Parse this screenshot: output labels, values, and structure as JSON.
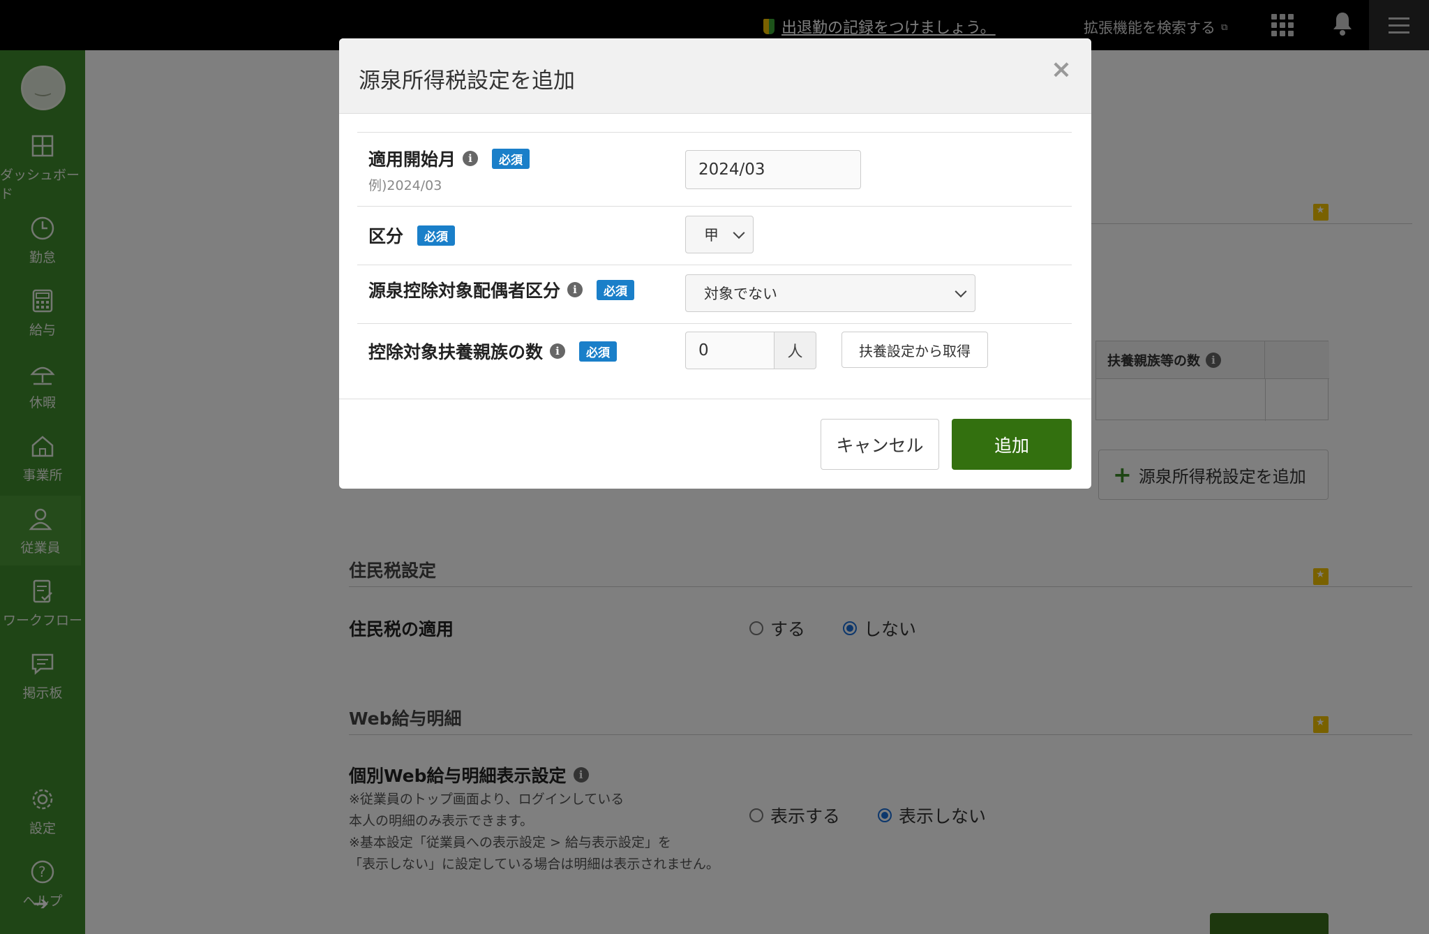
{
  "topbar": {
    "notice": "出退勤の記録をつけましょう。",
    "extension_search": "拡張機能を検索する"
  },
  "sidebar": {
    "items": [
      {
        "label": "ダッシュボード",
        "icon": "dashboard-icon"
      },
      {
        "label": "勤怠",
        "icon": "clock-icon"
      },
      {
        "label": "給与",
        "icon": "calculator-icon"
      },
      {
        "label": "休暇",
        "icon": "umbrella-icon"
      },
      {
        "label": "事業所",
        "icon": "home-icon"
      },
      {
        "label": "従業員",
        "icon": "person-icon"
      },
      {
        "label": "ワークフロー",
        "icon": "checklist-icon"
      },
      {
        "label": "掲示板",
        "icon": "chat-icon"
      },
      {
        "label": "設定",
        "icon": "gear-icon"
      },
      {
        "label": "ヘルプ",
        "icon": "help-icon"
      }
    ],
    "active": "従業員"
  },
  "background": {
    "dependents_header": "扶養親族等の数",
    "add_withholding_button": "源泉所得税設定を追加",
    "resident_tax_section": "住民税設定",
    "resident_tax_label": "住民税の適用",
    "resident_tax_options": [
      "する",
      "しない"
    ],
    "resident_tax_selected": "しない",
    "web_payslip_section": "Web給与明細",
    "web_payslip_label": "個別Web給与明細表示設定",
    "web_payslip_note": [
      "※従業員のトップ画面より、ログインしている",
      "本人の明細のみ表示できます。",
      "※基本設定「従業員への表示設定 > 給与表示設定」を",
      "「表示しない」に設定している場合は明細は表示されません。"
    ],
    "web_payslip_options": [
      "表示する",
      "表示しない"
    ],
    "web_payslip_selected": "表示しない"
  },
  "modal": {
    "title": "源泉所得税設定を追加",
    "required_badge": "必須",
    "fields": {
      "start_month": {
        "label": "適用開始月",
        "hint": "例)2024/03",
        "value": "2024/03"
      },
      "category": {
        "label": "区分",
        "value": "甲"
      },
      "spouse": {
        "label": "源泉控除対象配偶者区分",
        "value": "対象でない"
      },
      "dependents": {
        "label": "控除対象扶養親族の数",
        "value": "0",
        "unit": "人",
        "fetch_button": "扶養設定から取得"
      }
    },
    "cancel_button": "キャンセル",
    "add_button": "追加"
  },
  "colors": {
    "sidebar": "#3f8a2d",
    "primary_button": "#33700f",
    "required_badge": "#1a7fc9",
    "topbar": "#000000"
  }
}
